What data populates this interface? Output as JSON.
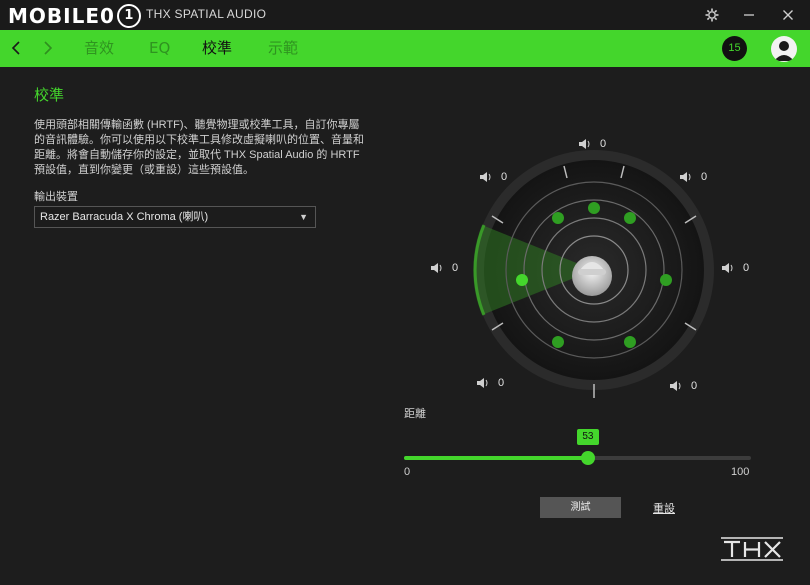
{
  "titlebar": {
    "watermark": "MOBILE01",
    "app_title": "THX SPATIAL AUDIO",
    "icons": [
      "gear-icon",
      "minimize-icon",
      "close-icon"
    ]
  },
  "nav": {
    "tabs": [
      {
        "label": "音效",
        "active": false
      },
      {
        "label": "EQ",
        "active": false
      },
      {
        "label": "校準",
        "active": true
      },
      {
        "label": "示範",
        "active": false
      }
    ],
    "notification_count": "15"
  },
  "calibration": {
    "title": "校準",
    "description": "使用頭部相關傳輸函數 (HRTF)、聽覺物理或校準工具，自訂你專屬的音訊體驗。你可以使用以下校準工具修改虛擬喇叭的位置、音量和距離。將會自動儲存你的設定，並取代 THX Spatial Audio 的 HRTF 預設值，直到你變更（或重設）這些預設值。",
    "device_label": "輸出裝置",
    "device_value": "Razer Barracuda X Chroma (喇叭)",
    "speakers": [
      {
        "name": "front-center",
        "value": "0"
      },
      {
        "name": "front-left",
        "value": "0"
      },
      {
        "name": "front-right",
        "value": "0"
      },
      {
        "name": "side-left",
        "value": "0"
      },
      {
        "name": "side-right",
        "value": "0"
      },
      {
        "name": "rear-left",
        "value": "0"
      },
      {
        "name": "rear-right",
        "value": "0"
      }
    ],
    "distance": {
      "label": "距離",
      "value": 53,
      "value_text": "53",
      "min": "0",
      "max": "100"
    },
    "test_label": "測試",
    "reset_label": "重設"
  },
  "brand": {
    "accent": "#44d62c",
    "logo": "THX"
  }
}
